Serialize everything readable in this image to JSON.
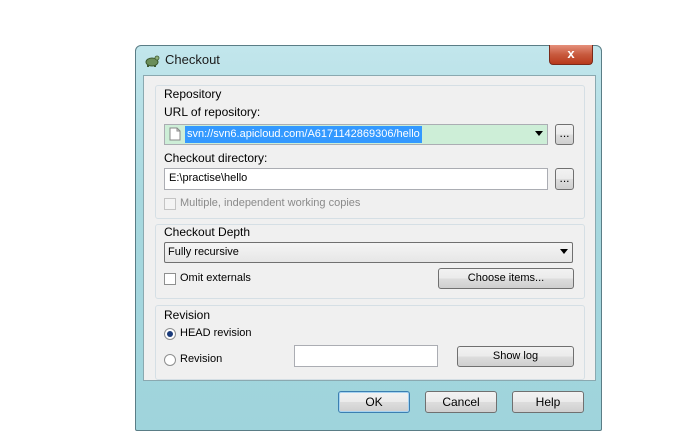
{
  "window": {
    "title": "Checkout",
    "close_label": "x"
  },
  "repository": {
    "group_label": "Repository",
    "url_label": "URL of repository:",
    "url_value": "svn://svn6.apicloud.com/A6171142869306/hello",
    "browse_label": "...",
    "dir_label": "Checkout directory:",
    "dir_value": "E:\\practise\\hello",
    "dir_browse_label": "...",
    "multiple_label": "Multiple, independent working copies"
  },
  "depth": {
    "group_label": "Checkout Depth",
    "selected": "Fully recursive",
    "omit_externals_label": "Omit externals",
    "choose_items_label": "Choose items..."
  },
  "revision": {
    "group_label": "Revision",
    "head_label": "HEAD revision",
    "revision_label": "Revision",
    "revision_value": "",
    "show_log_label": "Show log"
  },
  "buttons": {
    "ok": "OK",
    "cancel": "Cancel",
    "help": "Help"
  }
}
